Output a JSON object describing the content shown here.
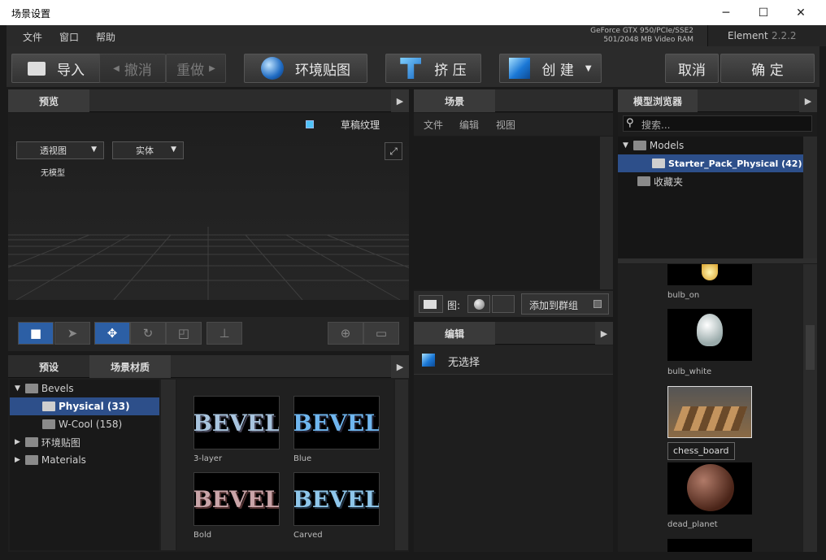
{
  "window": {
    "title": "场景设置",
    "controls": [
      "─",
      "☐",
      "✕"
    ]
  },
  "menu": {
    "items": [
      "文件",
      "窗口",
      "帮助"
    ]
  },
  "gpu": {
    "line1": "GeForce GTX 950/PCIe/SSE2",
    "line2": "501/2048 MB Video RAM"
  },
  "app": {
    "name": "Element",
    "version": "2.2.2"
  },
  "toolbar": {
    "import": "导入",
    "undo": "撤消",
    "redo": "重做",
    "env_map": "环境贴图",
    "extrude": "挤 压",
    "create": "创 建",
    "cancel": "取消",
    "ok": "确 定"
  },
  "preview": {
    "tab": "预览",
    "draft_texture": "草稿纹理",
    "view_mode": "透视图",
    "render_mode": "实体",
    "no_model": "无模型"
  },
  "scene": {
    "tab": "场景",
    "menu": [
      "文件",
      "编辑",
      "视图"
    ],
    "map_label": "图:",
    "add_group": "添加到群组"
  },
  "edit": {
    "tab": "编辑",
    "no_selection": "无选择"
  },
  "presets": {
    "tab1": "预设",
    "tab2": "场景材质",
    "tree": [
      {
        "label": "Bevels",
        "level": 0,
        "expanded": true
      },
      {
        "label": "Physical (33)",
        "level": 1,
        "selected": true
      },
      {
        "label": "W-Cool (158)",
        "level": 1
      },
      {
        "label": "环境贴图",
        "level": 0,
        "expanded": false
      },
      {
        "label": "Materials",
        "level": 0,
        "expanded": false
      }
    ],
    "thumbs": [
      {
        "label": "3-layer",
        "text": "BEVEL"
      },
      {
        "label": "Blue",
        "text": "BEVEL"
      },
      {
        "label": "Bold",
        "text": "BEVEL"
      },
      {
        "label": "Carved",
        "text": "BEVEL"
      }
    ]
  },
  "browser": {
    "tab": "模型浏览器",
    "search_placeholder": "搜索...",
    "tree": [
      {
        "label": "Models",
        "level": 0
      },
      {
        "label": "Starter_Pack_Physical (42)",
        "level": 1,
        "selected": true
      },
      {
        "label": "收藏夹",
        "level": 0
      }
    ],
    "models": [
      "bulb_on",
      "bulb_white",
      "chess_board",
      "dead_planet"
    ]
  },
  "colors": {
    "accent": "#2c5fa5",
    "selection": "#2d4f8a",
    "checkbox": "#4fc3f7"
  }
}
